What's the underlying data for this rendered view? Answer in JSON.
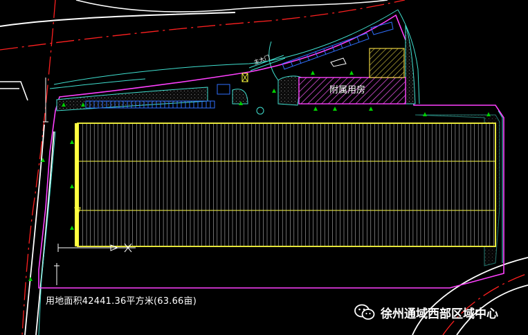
{
  "drawing": {
    "building_label": "附属用房",
    "entrance_label": "主大门",
    "area_note": "用地面积42441.36平方米(63.66亩)"
  },
  "watermark": {
    "text": "徐州通域西部区域中心",
    "icon": "wechat-icon"
  },
  "colors": {
    "background": "#000000",
    "road_edge": "#ffffff",
    "road_centerline": "#ff2020",
    "site_boundary": "#ff40ff",
    "curb": "#40e0d0",
    "solar_array": "#ffff40",
    "array_grid": "#c8c8c8",
    "building_hatch": "#b040b0",
    "parking": "#3070ff",
    "green_area": "#2a2a2a",
    "arrow": "#00d000"
  }
}
